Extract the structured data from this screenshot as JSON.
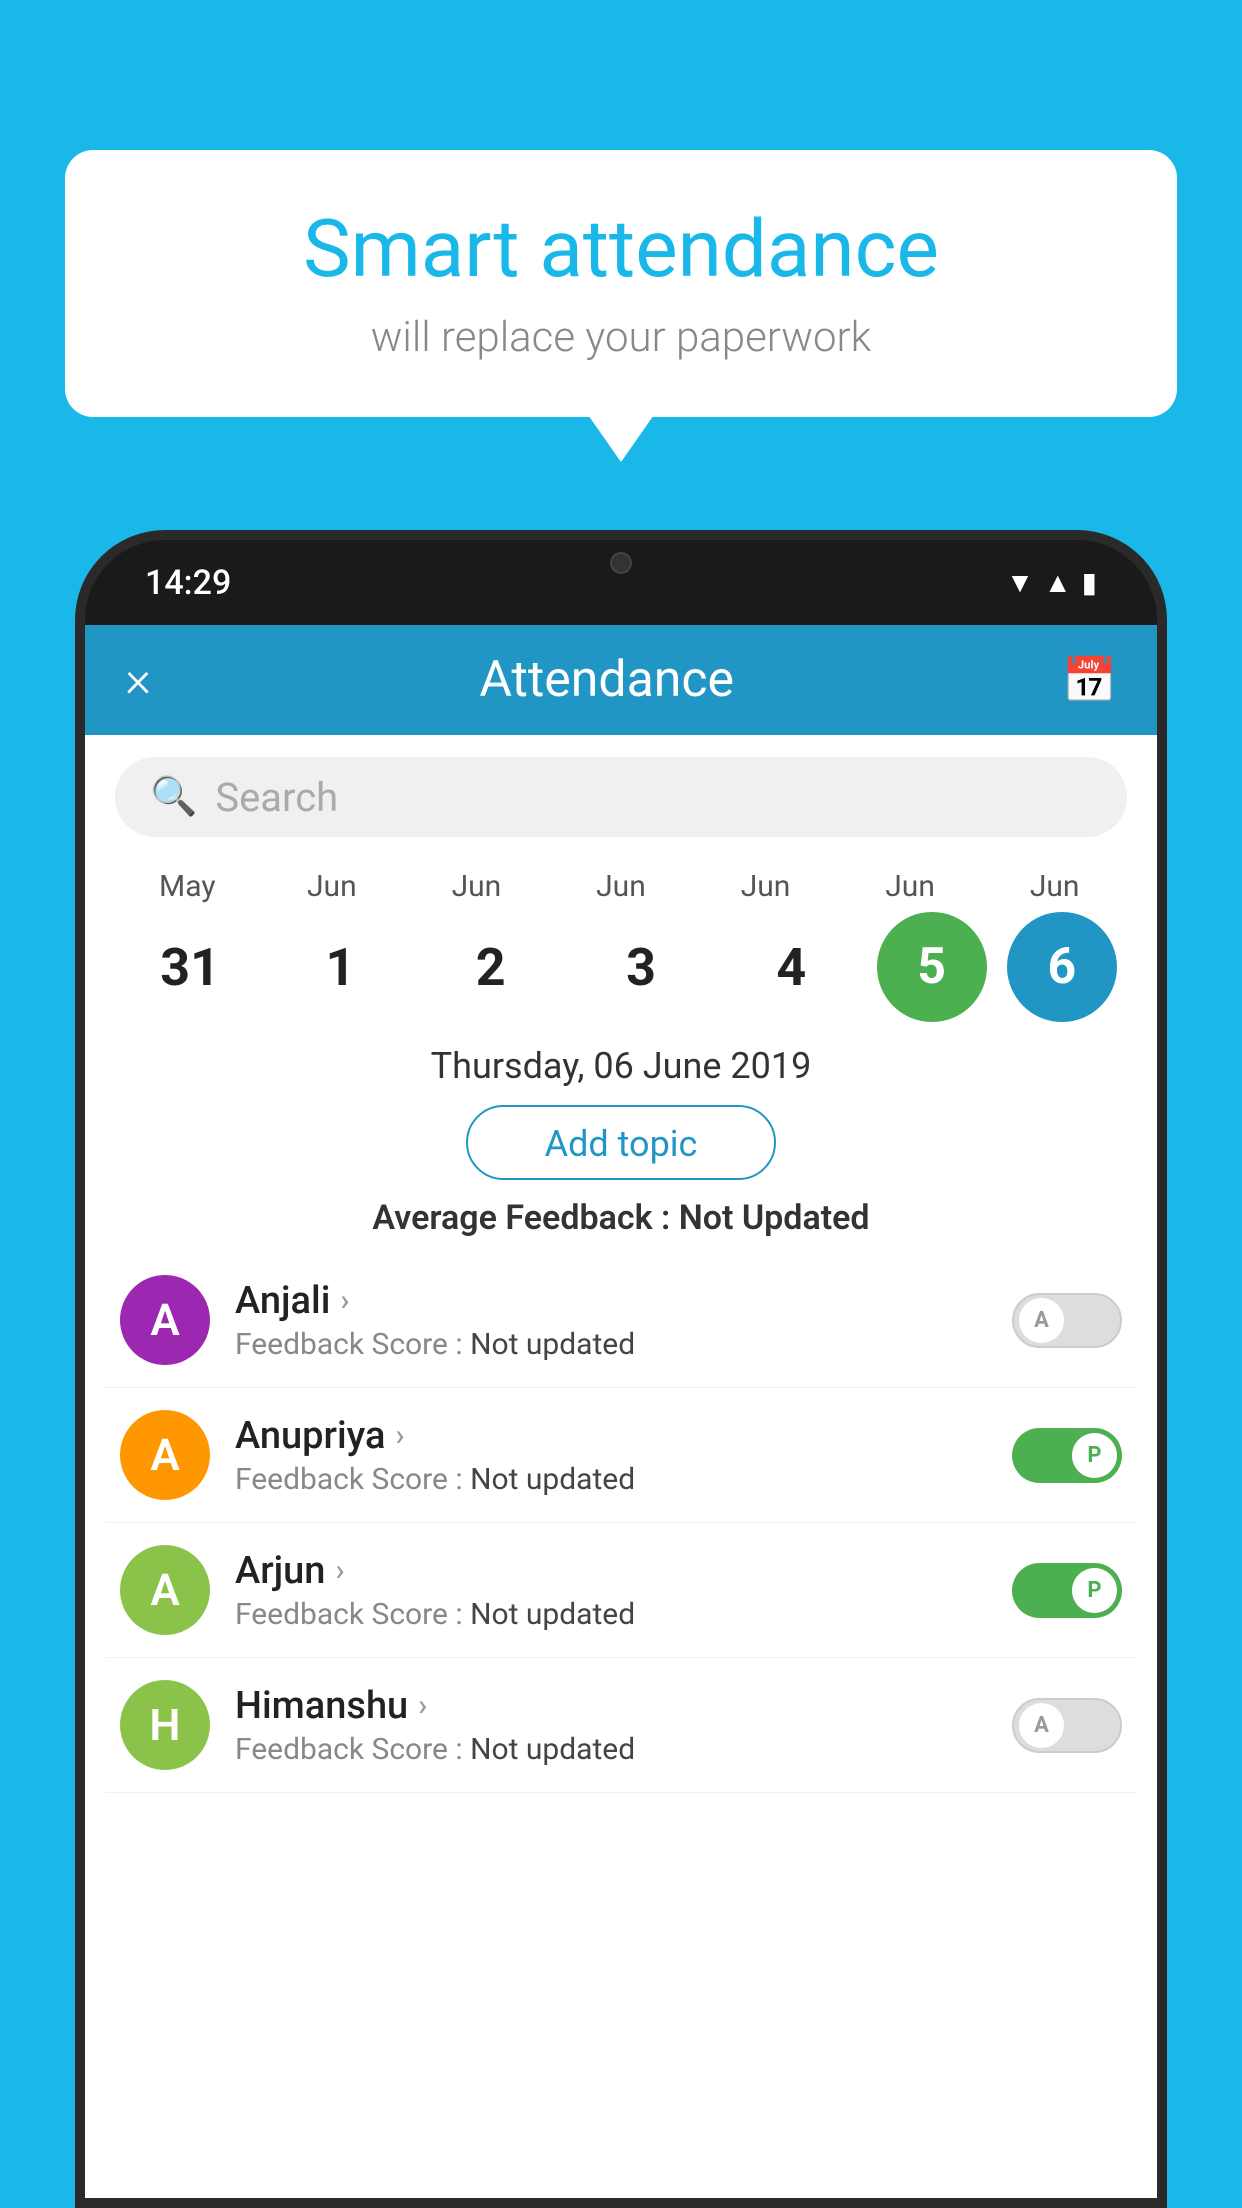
{
  "background_color": "#1ab8e8",
  "bubble": {
    "title": "Smart attendance",
    "subtitle": "will replace your paperwork"
  },
  "phone": {
    "time": "14:29",
    "status_icons": [
      "wifi",
      "signal",
      "battery"
    ]
  },
  "app": {
    "header": {
      "title": "Attendance",
      "close_label": "×",
      "calendar_icon": "📅"
    },
    "search": {
      "placeholder": "Search"
    },
    "calendar": {
      "months": [
        "May",
        "Jun",
        "Jun",
        "Jun",
        "Jun",
        "Jun",
        "Jun"
      ],
      "days": [
        "31",
        "1",
        "2",
        "3",
        "4",
        "5",
        "6"
      ],
      "selected_green_index": 5,
      "selected_blue_index": 6
    },
    "selected_date": "Thursday, 06 June 2019",
    "add_topic_label": "Add topic",
    "avg_feedback_label": "Average Feedback :",
    "avg_feedback_value": "Not Updated",
    "students": [
      {
        "name": "Anjali",
        "avatar_letter": "A",
        "avatar_color": "#9c27b0",
        "feedback_label": "Feedback Score :",
        "feedback_value": "Not updated",
        "toggle_state": "off",
        "toggle_label": "A"
      },
      {
        "name": "Anupriya",
        "avatar_letter": "A",
        "avatar_color": "#ff9800",
        "feedback_label": "Feedback Score :",
        "feedback_value": "Not updated",
        "toggle_state": "on",
        "toggle_label": "P"
      },
      {
        "name": "Arjun",
        "avatar_letter": "A",
        "avatar_color": "#8bc34a",
        "feedback_label": "Feedback Score :",
        "feedback_value": "Not updated",
        "toggle_state": "on",
        "toggle_label": "P"
      },
      {
        "name": "Himanshu",
        "avatar_letter": "H",
        "avatar_color": "#8bc34a",
        "feedback_label": "Feedback Score :",
        "feedback_value": "Not updated",
        "toggle_state": "off",
        "toggle_label": "A"
      }
    ]
  }
}
